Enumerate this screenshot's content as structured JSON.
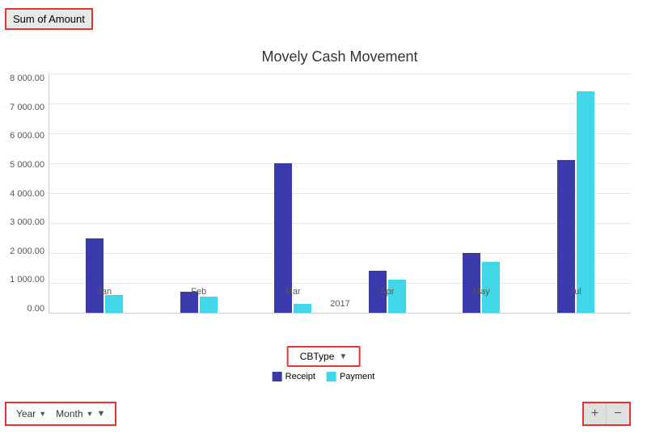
{
  "title": "Sum of Amount",
  "chart": {
    "title": "Movely Cash Movement",
    "y_axis": {
      "labels": [
        "8 000.00",
        "7 000.00",
        "6 000.00",
        "5 000.00",
        "4 000.00",
        "3 000.00",
        "2 000.00",
        "1 000.00",
        "0.00"
      ],
      "max": 8000
    },
    "x_axis": {
      "labels": [
        "Jan",
        "Feb",
        "Mar",
        "Apr",
        "May",
        "Jul"
      ],
      "year": "2017"
    },
    "bars": [
      {
        "month": "Jan",
        "receipt": 2500,
        "payment": 600
      },
      {
        "month": "Feb",
        "receipt": 700,
        "payment": 550
      },
      {
        "month": "Mar",
        "receipt": 5000,
        "payment": 300
      },
      {
        "month": "Apr",
        "receipt": 1400,
        "payment": 1100
      },
      {
        "month": "May",
        "receipt": 2000,
        "payment": 1700
      },
      {
        "month": "Jul",
        "receipt": 5100,
        "payment": 7400
      }
    ]
  },
  "cbtype": {
    "label": "CBType",
    "arrow": "▼"
  },
  "legend": {
    "receipt_label": "Receipt",
    "receipt_color": "#3a3aaa",
    "payment_label": "Payment",
    "payment_color": "#40d8e8"
  },
  "filters": {
    "year_label": "Year",
    "month_label": "Month",
    "year_arrow": "▼",
    "month_arrow": "▼"
  },
  "zoom": {
    "plus": "+",
    "minus": "−"
  }
}
